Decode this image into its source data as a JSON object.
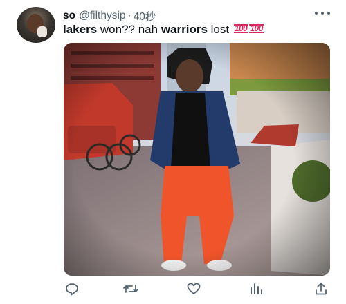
{
  "tweet": {
    "display_name": "so",
    "handle": "@filthysip",
    "separator": "·",
    "time": "40秒",
    "text_bold_1": "lakers",
    "text_1": " won?? nah ",
    "text_bold_2": "warriors",
    "text_2": " lost ",
    "emoji": [
      "hundred-points-emoji",
      "hundred-points-emoji"
    ]
  },
  "icons": {
    "more": "more-horizontal-icon",
    "reply": "reply-icon",
    "retweet": "retweet-icon",
    "like": "heart-icon",
    "views": "views-icon",
    "share": "share-icon"
  },
  "colors": {
    "text": "#0f1419",
    "secondary": "#536471",
    "emoji_red": "#e0245e"
  }
}
